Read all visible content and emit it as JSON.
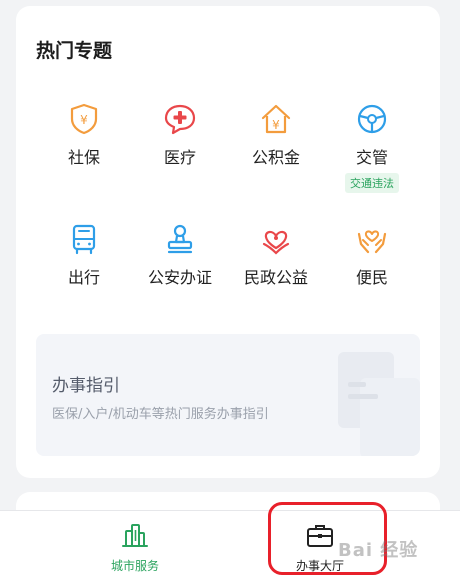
{
  "section": {
    "title": "热门专题",
    "items": [
      {
        "label": "社保",
        "icon": "shield-yuan-icon",
        "color": "#f39c3d"
      },
      {
        "label": "医疗",
        "icon": "medical-cross-icon",
        "color": "#e9474a"
      },
      {
        "label": "公积金",
        "icon": "house-yuan-icon",
        "color": "#f39c3d"
      },
      {
        "label": "交管",
        "icon": "steering-wheel-icon",
        "color": "#2e9ee8",
        "badge": "交通违法"
      },
      {
        "label": "出行",
        "icon": "bus-icon",
        "color": "#2e9ee8"
      },
      {
        "label": "公安办证",
        "icon": "stamp-icon",
        "color": "#2e9ee8"
      },
      {
        "label": "民政公益",
        "icon": "heart-flower-icon",
        "color": "#e9474a"
      },
      {
        "label": "便民",
        "icon": "hands-heart-icon",
        "color": "#f39c3d"
      }
    ]
  },
  "guide": {
    "title": "办事指引",
    "subtitle": "医保/入户/机动车等热门服务办事指引"
  },
  "tabbar": {
    "tabs": [
      {
        "label": "城市服务",
        "icon": "city-buildings-icon",
        "active": true
      },
      {
        "label": "办事大厅",
        "icon": "briefcase-icon",
        "active": false
      }
    ]
  },
  "watermark": "Bai 经验",
  "colors": {
    "accent_green": "#2aa35e",
    "highlight_red": "#e8202a"
  }
}
